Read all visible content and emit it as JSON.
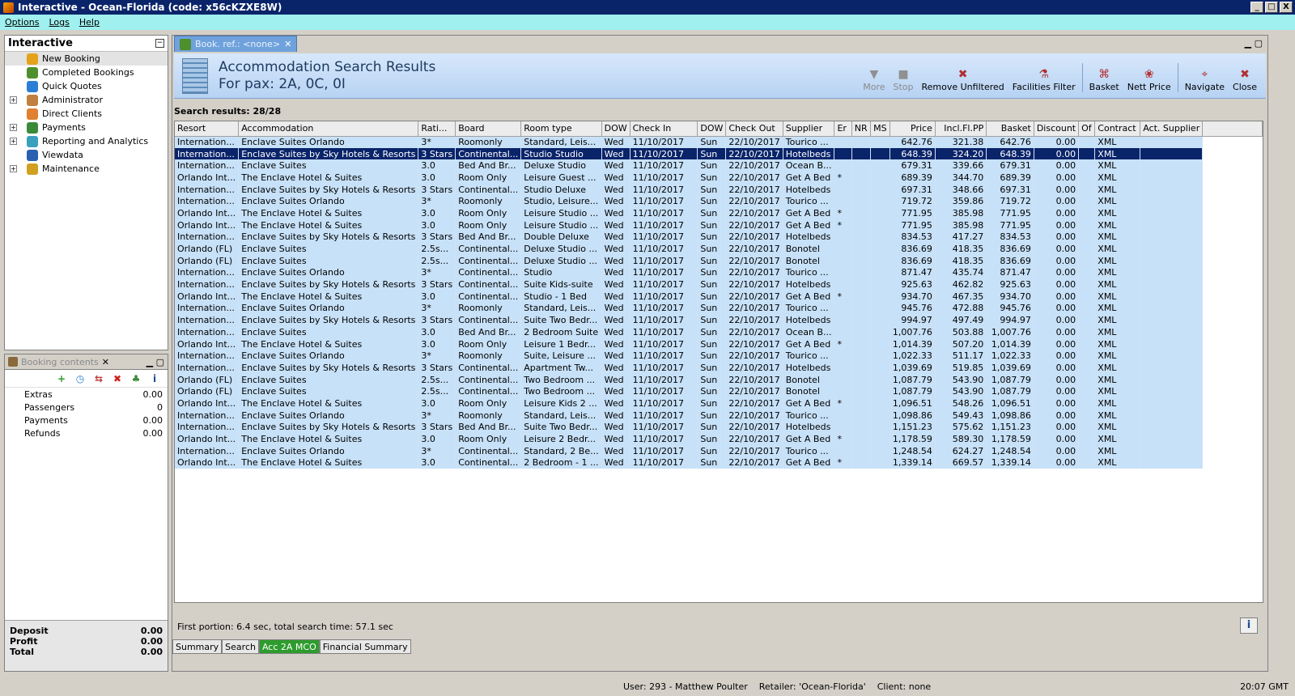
{
  "window": {
    "title": "Interactive - Ocean-Florida (code: x56cKZXE8W)",
    "buttons": [
      "_",
      "□",
      "X"
    ]
  },
  "menu": [
    "Options",
    "Logs",
    "Help"
  ],
  "nav": {
    "title": "Interactive",
    "items": [
      {
        "label": "New Booking",
        "expandable": false,
        "color": "#e3a21a"
      },
      {
        "label": "Completed Bookings",
        "expandable": false,
        "color": "#4e8f2e"
      },
      {
        "label": "Quick Quotes",
        "expandable": false,
        "color": "#2a7fd4"
      },
      {
        "label": "Administrator",
        "expandable": true,
        "color": "#c08040"
      },
      {
        "label": "Direct Clients",
        "expandable": false,
        "color": "#e08030"
      },
      {
        "label": "Payments",
        "expandable": true,
        "color": "#3a8a3a"
      },
      {
        "label": "Reporting and Analytics",
        "expandable": true,
        "color": "#3aa0c0"
      },
      {
        "label": "Viewdata",
        "expandable": false,
        "color": "#2a60b0"
      },
      {
        "label": "Maintenance",
        "expandable": true,
        "color": "#d0a020"
      }
    ]
  },
  "booking": {
    "tab": "Booking contents",
    "rows": [
      {
        "label": "Extras",
        "value": "0.00"
      },
      {
        "label": "Passengers",
        "value": "0"
      },
      {
        "label": "Payments",
        "value": "0.00"
      },
      {
        "label": "Refunds",
        "value": "0.00"
      }
    ],
    "totals": [
      {
        "label": "Deposit",
        "value": "0.00"
      },
      {
        "label": "Profit",
        "value": "0.00"
      },
      {
        "label": "Total",
        "value": "0.00"
      }
    ]
  },
  "main": {
    "tab": "Book. ref.: <none>",
    "header_title": "Accommodation Search Results",
    "header_pax": "For pax: 2A, 0C, 0I",
    "toolbar": [
      {
        "label": "More",
        "icon": "more-icon",
        "glyph": "▼",
        "enabled": false
      },
      {
        "label": "Stop",
        "icon": "stop-icon",
        "glyph": "■",
        "enabled": false
      },
      {
        "label": "Remove Unfiltered",
        "icon": "remove-unfiltered-icon",
        "glyph": "✖",
        "enabled": true
      },
      {
        "label": "Facilities Filter",
        "icon": "facilities-filter-icon",
        "glyph": "⚗",
        "enabled": true
      },
      {
        "label": "Basket",
        "icon": "basket-icon",
        "glyph": "⌘",
        "enabled": true
      },
      {
        "label": "Nett Price",
        "icon": "nett-price-icon",
        "glyph": "❀",
        "enabled": true
      },
      {
        "label": "Navigate",
        "icon": "navigate-icon",
        "glyph": "⌖",
        "enabled": true
      },
      {
        "label": "Close",
        "icon": "close-icon",
        "glyph": "✖",
        "enabled": true
      }
    ],
    "results_label": "Search results: 28/28",
    "columns": [
      "Resort",
      "Accommodation",
      "Rati...",
      "Board",
      "Room type",
      "DOW",
      "Check In",
      "DOW",
      "Check Out",
      "Supplier",
      "Er",
      "NR",
      "MS",
      "Price",
      "Incl.Fl.PP",
      "Basket",
      "Discount",
      "Of",
      "Contract",
      "Act. Supplier"
    ],
    "rows": [
      [
        "Internation...",
        "Enclave Suites Orlando",
        "3*",
        "Roomonly",
        "Standard, Leis...",
        "Wed",
        "11/10/2017",
        "Sun",
        "22/10/2017",
        "Tourico ...",
        "",
        "",
        "",
        "642.76",
        "321.38",
        "642.76",
        "0.00",
        "",
        "XML",
        ""
      ],
      [
        "Internation...",
        "Enclave Suites by Sky Hotels & Resorts",
        "3 Stars",
        "Continental...",
        "Studio Studio",
        "Wed",
        "11/10/2017",
        "Sun",
        "22/10/2017",
        "Hotelbeds",
        "",
        "",
        "",
        "648.39",
        "324.20",
        "648.39",
        "0.00",
        "",
        "XML",
        ""
      ],
      [
        "Internation...",
        "Enclave Suites",
        "3.0",
        "Bed And Br...",
        "Deluxe Studio",
        "Wed",
        "11/10/2017",
        "Sun",
        "22/10/2017",
        "Ocean B...",
        "",
        "",
        "",
        "679.31",
        "339.66",
        "679.31",
        "0.00",
        "",
        "XML",
        ""
      ],
      [
        "Orlando Int...",
        "The Enclave Hotel & Suites",
        "3.0",
        "Room Only",
        "Leisure Guest ...",
        "Wed",
        "11/10/2017",
        "Sun",
        "22/10/2017",
        "Get A Bed",
        "*",
        "",
        "",
        "689.39",
        "344.70",
        "689.39",
        "0.00",
        "",
        "XML",
        ""
      ],
      [
        "Internation...",
        "Enclave Suites by Sky Hotels & Resorts",
        "3 Stars",
        "Continental...",
        "Studio Deluxe",
        "Wed",
        "11/10/2017",
        "Sun",
        "22/10/2017",
        "Hotelbeds",
        "",
        "",
        "",
        "697.31",
        "348.66",
        "697.31",
        "0.00",
        "",
        "XML",
        ""
      ],
      [
        "Internation...",
        "Enclave Suites Orlando",
        "3*",
        "Roomonly",
        "Studio, Leisure...",
        "Wed",
        "11/10/2017",
        "Sun",
        "22/10/2017",
        "Tourico ...",
        "",
        "",
        "",
        "719.72",
        "359.86",
        "719.72",
        "0.00",
        "",
        "XML",
        ""
      ],
      [
        "Orlando Int...",
        "The Enclave Hotel & Suites",
        "3.0",
        "Room Only",
        "Leisure Studio ...",
        "Wed",
        "11/10/2017",
        "Sun",
        "22/10/2017",
        "Get A Bed",
        "*",
        "",
        "",
        "771.95",
        "385.98",
        "771.95",
        "0.00",
        "",
        "XML",
        ""
      ],
      [
        "Orlando Int...",
        "The Enclave Hotel & Suites",
        "3.0",
        "Room Only",
        "Leisure Studio ...",
        "Wed",
        "11/10/2017",
        "Sun",
        "22/10/2017",
        "Get A Bed",
        "*",
        "",
        "",
        "771.95",
        "385.98",
        "771.95",
        "0.00",
        "",
        "XML",
        ""
      ],
      [
        "Internation...",
        "Enclave Suites by Sky Hotels & Resorts",
        "3 Stars",
        "Bed And Br...",
        "Double Deluxe",
        "Wed",
        "11/10/2017",
        "Sun",
        "22/10/2017",
        "Hotelbeds",
        "",
        "",
        "",
        "834.53",
        "417.27",
        "834.53",
        "0.00",
        "",
        "XML",
        ""
      ],
      [
        "Orlando (FL)",
        "Enclave Suites",
        "2.5s...",
        "Continental...",
        "Deluxe Studio ...",
        "Wed",
        "11/10/2017",
        "Sun",
        "22/10/2017",
        "Bonotel",
        "",
        "",
        "",
        "836.69",
        "418.35",
        "836.69",
        "0.00",
        "",
        "XML",
        ""
      ],
      [
        "Orlando (FL)",
        "Enclave Suites",
        "2.5s...",
        "Continental...",
        "Deluxe Studio ...",
        "Wed",
        "11/10/2017",
        "Sun",
        "22/10/2017",
        "Bonotel",
        "",
        "",
        "",
        "836.69",
        "418.35",
        "836.69",
        "0.00",
        "",
        "XML",
        ""
      ],
      [
        "Internation...",
        "Enclave Suites Orlando",
        "3*",
        "Continental...",
        "Studio",
        "Wed",
        "11/10/2017",
        "Sun",
        "22/10/2017",
        "Tourico ...",
        "",
        "",
        "",
        "871.47",
        "435.74",
        "871.47",
        "0.00",
        "",
        "XML",
        ""
      ],
      [
        "Internation...",
        "Enclave Suites by Sky Hotels & Resorts",
        "3 Stars",
        "Continental...",
        "Suite Kids-suite",
        "Wed",
        "11/10/2017",
        "Sun",
        "22/10/2017",
        "Hotelbeds",
        "",
        "",
        "",
        "925.63",
        "462.82",
        "925.63",
        "0.00",
        "",
        "XML",
        ""
      ],
      [
        "Orlando Int...",
        "The Enclave Hotel & Suites",
        "3.0",
        "Continental...",
        "Studio - 1 Bed",
        "Wed",
        "11/10/2017",
        "Sun",
        "22/10/2017",
        "Get A Bed",
        "*",
        "",
        "",
        "934.70",
        "467.35",
        "934.70",
        "0.00",
        "",
        "XML",
        ""
      ],
      [
        "Internation...",
        "Enclave Suites Orlando",
        "3*",
        "Roomonly",
        "Standard, Leis...",
        "Wed",
        "11/10/2017",
        "Sun",
        "22/10/2017",
        "Tourico ...",
        "",
        "",
        "",
        "945.76",
        "472.88",
        "945.76",
        "0.00",
        "",
        "XML",
        ""
      ],
      [
        "Internation...",
        "Enclave Suites by Sky Hotels & Resorts",
        "3 Stars",
        "Continental...",
        "Suite Two Bedr...",
        "Wed",
        "11/10/2017",
        "Sun",
        "22/10/2017",
        "Hotelbeds",
        "",
        "",
        "",
        "994.97",
        "497.49",
        "994.97",
        "0.00",
        "",
        "XML",
        ""
      ],
      [
        "Internation...",
        "Enclave Suites",
        "3.0",
        "Bed And Br...",
        "2 Bedroom Suite",
        "Wed",
        "11/10/2017",
        "Sun",
        "22/10/2017",
        "Ocean B...",
        "",
        "",
        "",
        "1,007.76",
        "503.88",
        "1,007.76",
        "0.00",
        "",
        "XML",
        ""
      ],
      [
        "Orlando Int...",
        "The Enclave Hotel & Suites",
        "3.0",
        "Room Only",
        "Leisure 1 Bedr...",
        "Wed",
        "11/10/2017",
        "Sun",
        "22/10/2017",
        "Get A Bed",
        "*",
        "",
        "",
        "1,014.39",
        "507.20",
        "1,014.39",
        "0.00",
        "",
        "XML",
        ""
      ],
      [
        "Internation...",
        "Enclave Suites Orlando",
        "3*",
        "Roomonly",
        "Suite, Leisure ...",
        "Wed",
        "11/10/2017",
        "Sun",
        "22/10/2017",
        "Tourico ...",
        "",
        "",
        "",
        "1,022.33",
        "511.17",
        "1,022.33",
        "0.00",
        "",
        "XML",
        ""
      ],
      [
        "Internation...",
        "Enclave Suites by Sky Hotels & Resorts",
        "3 Stars",
        "Continental...",
        "Apartment Tw...",
        "Wed",
        "11/10/2017",
        "Sun",
        "22/10/2017",
        "Hotelbeds",
        "",
        "",
        "",
        "1,039.69",
        "519.85",
        "1,039.69",
        "0.00",
        "",
        "XML",
        ""
      ],
      [
        "Orlando (FL)",
        "Enclave Suites",
        "2.5s...",
        "Continental...",
        "Two Bedroom ...",
        "Wed",
        "11/10/2017",
        "Sun",
        "22/10/2017",
        "Bonotel",
        "",
        "",
        "",
        "1,087.79",
        "543.90",
        "1,087.79",
        "0.00",
        "",
        "XML",
        ""
      ],
      [
        "Orlando (FL)",
        "Enclave Suites",
        "2.5s...",
        "Continental...",
        "Two Bedroom ...",
        "Wed",
        "11/10/2017",
        "Sun",
        "22/10/2017",
        "Bonotel",
        "",
        "",
        "",
        "1,087.79",
        "543.90",
        "1,087.79",
        "0.00",
        "",
        "XML",
        ""
      ],
      [
        "Orlando Int...",
        "The Enclave Hotel & Suites",
        "3.0",
        "Room Only",
        "Leisure Kids 2 ...",
        "Wed",
        "11/10/2017",
        "Sun",
        "22/10/2017",
        "Get A Bed",
        "*",
        "",
        "",
        "1,096.51",
        "548.26",
        "1,096.51",
        "0.00",
        "",
        "XML",
        ""
      ],
      [
        "Internation...",
        "Enclave Suites Orlando",
        "3*",
        "Roomonly",
        "Standard, Leis...",
        "Wed",
        "11/10/2017",
        "Sun",
        "22/10/2017",
        "Tourico ...",
        "",
        "",
        "",
        "1,098.86",
        "549.43",
        "1,098.86",
        "0.00",
        "",
        "XML",
        ""
      ],
      [
        "Internation...",
        "Enclave Suites by Sky Hotels & Resorts",
        "3 Stars",
        "Bed And Br...",
        "Suite Two Bedr...",
        "Wed",
        "11/10/2017",
        "Sun",
        "22/10/2017",
        "Hotelbeds",
        "",
        "",
        "",
        "1,151.23",
        "575.62",
        "1,151.23",
        "0.00",
        "",
        "XML",
        ""
      ],
      [
        "Orlando Int...",
        "The Enclave Hotel & Suites",
        "3.0",
        "Room Only",
        "Leisure 2 Bedr...",
        "Wed",
        "11/10/2017",
        "Sun",
        "22/10/2017",
        "Get A Bed",
        "*",
        "",
        "",
        "1,178.59",
        "589.30",
        "1,178.59",
        "0.00",
        "",
        "XML",
        ""
      ],
      [
        "Internation...",
        "Enclave Suites Orlando",
        "3*",
        "Continental...",
        "Standard, 2 Be...",
        "Wed",
        "11/10/2017",
        "Sun",
        "22/10/2017",
        "Tourico ...",
        "",
        "",
        "",
        "1,248.54",
        "624.27",
        "1,248.54",
        "0.00",
        "",
        "XML",
        ""
      ],
      [
        "Orlando Int...",
        "The Enclave Hotel & Suites",
        "3.0",
        "Continental...",
        "2 Bedroom - 1 ...",
        "Wed",
        "11/10/2017",
        "Sun",
        "22/10/2017",
        "Get A Bed",
        "*",
        "",
        "",
        "1,339.14",
        "669.57",
        "1,339.14",
        "0.00",
        "",
        "XML",
        ""
      ]
    ],
    "selected_row": 1,
    "status_line": "First portion: 6.4 sec, total search time: 57.1 sec",
    "bottom_tabs": [
      {
        "label": "Summary",
        "active": false
      },
      {
        "label": "Search",
        "active": false
      },
      {
        "label": "Acc 2A MCO",
        "active": true
      },
      {
        "label": "Financial Summary",
        "active": false
      }
    ]
  },
  "statusbar": {
    "user": "User: 293 - Matthew Poulter    Retailer: 'Ocean-Florida'    Client: none",
    "time": "20:07 GMT"
  }
}
